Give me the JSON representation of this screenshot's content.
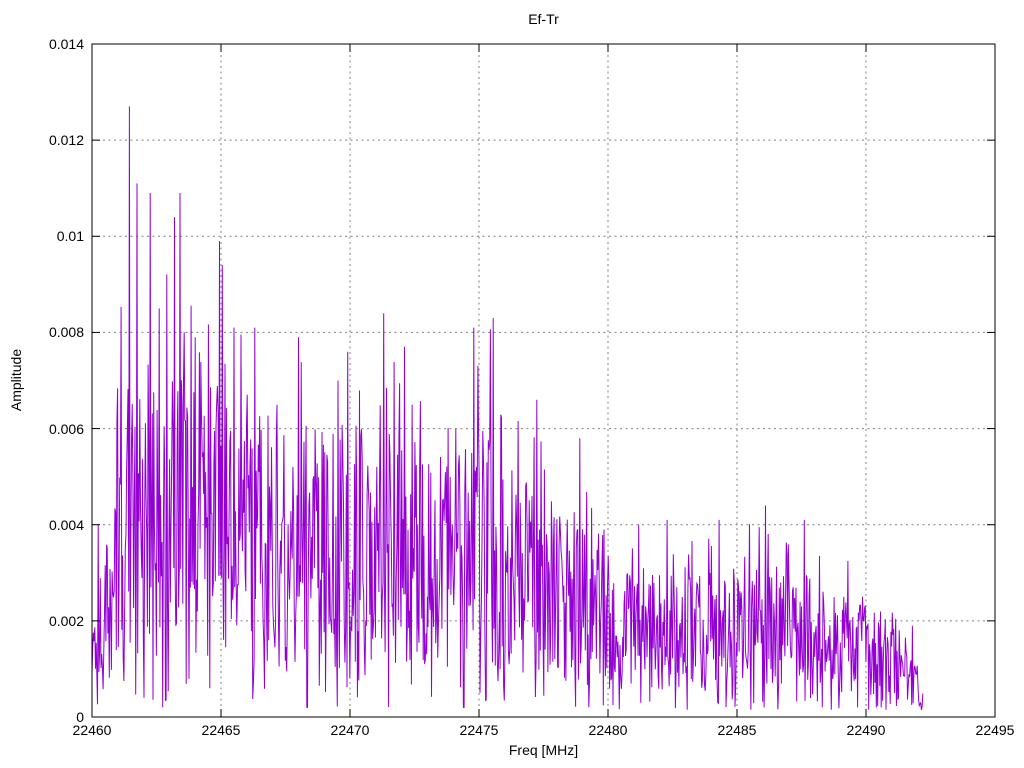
{
  "page": {
    "background": "#ffffff",
    "text_color": "#000000"
  },
  "chart_data": {
    "type": "line",
    "title": "Ef-Tr",
    "xlabel": "Freq [MHz]",
    "ylabel": "Amplitude",
    "xlim": [
      22460,
      22495
    ],
    "ylim": [
      0,
      0.014
    ],
    "xticks": [
      {
        "value": 22460,
        "label": "22460"
      },
      {
        "value": 22465,
        "label": "22465"
      },
      {
        "value": 22470,
        "label": "22470"
      },
      {
        "value": 22475,
        "label": "22475"
      },
      {
        "value": 22480,
        "label": "22480"
      },
      {
        "value": 22485,
        "label": "22485"
      },
      {
        "value": 22490,
        "label": "22490"
      },
      {
        "value": 22495,
        "label": "22495"
      }
    ],
    "yticks": [
      {
        "value": 0,
        "label": "0"
      },
      {
        "value": 0.002,
        "label": "0.002"
      },
      {
        "value": 0.004,
        "label": "0.004"
      },
      {
        "value": 0.006,
        "label": "0.006"
      },
      {
        "value": 0.008,
        "label": "0.008"
      },
      {
        "value": 0.01,
        "label": "0.01"
      },
      {
        "value": 0.012,
        "label": "0.012"
      },
      {
        "value": 0.014,
        "label": "0.014"
      }
    ],
    "grid": "dotted",
    "legend": "none",
    "line_color": "#9400D3",
    "grid_color": "#808080",
    "border_color": "#000000",
    "data_range": [
      22460,
      22492.2
    ],
    "samples": 1200,
    "noise_seed": 1337,
    "envelope": [
      [
        22460.0,
        0.0042,
        0.0016
      ],
      [
        22460.6,
        0.0046,
        0.0022
      ],
      [
        22461.0,
        0.0075,
        0.0032
      ],
      [
        22461.45,
        0.0127,
        0.0042
      ],
      [
        22462.0,
        0.0111,
        0.0045
      ],
      [
        22462.6,
        0.0092,
        0.004
      ],
      [
        22463.3,
        0.0109,
        0.0045
      ],
      [
        22464.0,
        0.008,
        0.0038
      ],
      [
        22464.95,
        0.0099,
        0.0042
      ],
      [
        22465.6,
        0.008,
        0.0038
      ],
      [
        22466.3,
        0.0081,
        0.0036
      ],
      [
        22467.2,
        0.007,
        0.0034
      ],
      [
        22468.1,
        0.0079,
        0.0036
      ],
      [
        22469.0,
        0.0066,
        0.0034
      ],
      [
        22469.9,
        0.0076,
        0.0038
      ],
      [
        22470.8,
        0.0065,
        0.0036
      ],
      [
        22471.3,
        0.0084,
        0.004
      ],
      [
        22472.2,
        0.0077,
        0.0036
      ],
      [
        22473.0,
        0.0065,
        0.0033
      ],
      [
        22474.0,
        0.0062,
        0.0032
      ],
      [
        22474.8,
        0.0081,
        0.0035
      ],
      [
        22475.55,
        0.0083,
        0.0034
      ],
      [
        22476.4,
        0.0061,
        0.003
      ],
      [
        22477.35,
        0.0066,
        0.0028
      ],
      [
        22478.2,
        0.0051,
        0.0025
      ],
      [
        22478.9,
        0.0058,
        0.0024
      ],
      [
        22479.6,
        0.0042,
        0.0021
      ],
      [
        22480.5,
        0.0034,
        0.0019
      ],
      [
        22481.4,
        0.0037,
        0.0018
      ],
      [
        22482.2,
        0.0041,
        0.0018
      ],
      [
        22483.1,
        0.0036,
        0.0017
      ],
      [
        22484.0,
        0.0041,
        0.0018
      ],
      [
        22485.0,
        0.0038,
        0.0018
      ],
      [
        22485.8,
        0.0045,
        0.0019
      ],
      [
        22486.5,
        0.0041,
        0.0019
      ],
      [
        22487.3,
        0.0037,
        0.0018
      ],
      [
        22488.2,
        0.0034,
        0.0017
      ],
      [
        22489.0,
        0.0036,
        0.0016
      ],
      [
        22489.8,
        0.0031,
        0.0015
      ],
      [
        22490.5,
        0.0023,
        0.0013
      ],
      [
        22491.2,
        0.0022,
        0.0012
      ],
      [
        22491.8,
        0.0016,
        0.0008
      ],
      [
        22492.2,
        0.0006,
        0.0003
      ]
    ],
    "peaks": [
      [
        22460.25,
        0.004
      ],
      [
        22461.45,
        0.0127
      ],
      [
        22461.75,
        0.0111
      ],
      [
        22462.25,
        0.0109
      ],
      [
        22462.6,
        0.0085
      ],
      [
        22463.2,
        0.0104
      ],
      [
        22463.4,
        0.0109
      ],
      [
        22464.0,
        0.0079
      ],
      [
        22464.95,
        0.0099
      ],
      [
        22465.05,
        0.0094
      ],
      [
        22465.5,
        0.0081
      ],
      [
        22466.3,
        0.0081
      ],
      [
        22468.0,
        0.0079
      ],
      [
        22469.9,
        0.0076
      ],
      [
        22471.3,
        0.0084
      ],
      [
        22472.1,
        0.0077
      ],
      [
        22474.8,
        0.0081
      ],
      [
        22475.55,
        0.0083
      ],
      [
        22477.25,
        0.0066
      ],
      [
        22478.9,
        0.0058
      ],
      [
        22481.2,
        0.004
      ],
      [
        22482.3,
        0.0041
      ],
      [
        22484.3,
        0.0041
      ],
      [
        22486.1,
        0.0044
      ],
      [
        22487.6,
        0.0041
      ],
      [
        22491.8,
        0.0019
      ]
    ]
  }
}
